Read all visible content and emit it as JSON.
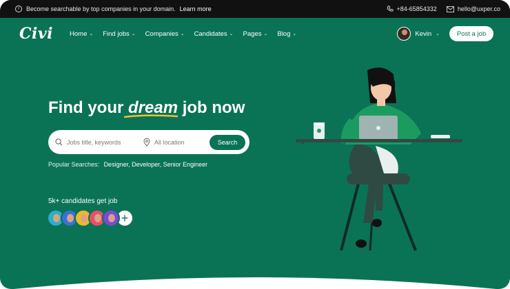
{
  "topbar": {
    "announcement": "Become searchable by top companies in your domain.",
    "learn_more": "Learn more",
    "phone": "+84-65854332",
    "email": "hello@uxper.co"
  },
  "nav": {
    "logo": "Civi",
    "items": [
      {
        "label": "Home"
      },
      {
        "label": "Find jobs"
      },
      {
        "label": "Companies"
      },
      {
        "label": "Candidates"
      },
      {
        "label": "Pages"
      },
      {
        "label": "Blog"
      }
    ],
    "user_name": "Kevin",
    "post_job": "Post a job"
  },
  "hero": {
    "headline_before": "Find your ",
    "headline_highlight": "dream",
    "headline_after": " job now",
    "search_placeholder": "Jobs title, keywords",
    "location_placeholder": "All location",
    "search_button": "Search",
    "popular_label": "Popular Searches:",
    "popular_terms": "Designer, Developer, Senior Engineer",
    "candidates_text": "5k+ candidates get job",
    "avatar_colors": [
      "#2ab0c8",
      "#3b6fd8",
      "#f0b72a",
      "#e8506a",
      "#7a4ad8"
    ]
  },
  "colors": {
    "brand_green": "#0a7356",
    "topbar": "#111111",
    "accent_yellow": "#f3c12d"
  },
  "icons": [
    "info-icon",
    "phone-icon",
    "mail-icon",
    "search-icon",
    "location-pin-icon",
    "chevron-down-icon",
    "plus-icon"
  ]
}
